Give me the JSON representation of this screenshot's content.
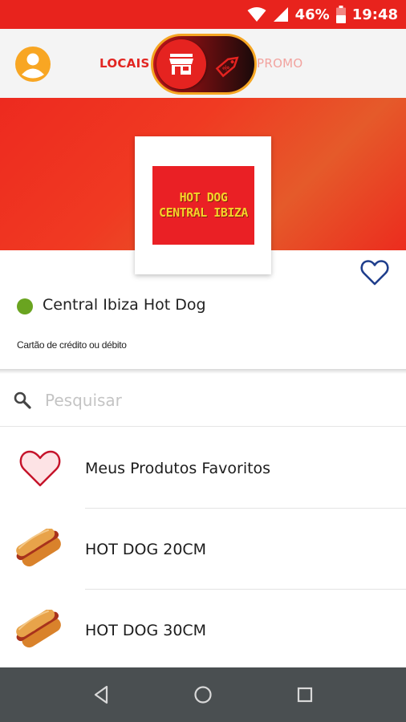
{
  "status_bar": {
    "battery": "46%",
    "time": "19:48",
    "icons": [
      "wifi-icon",
      "signal-icon",
      "battery-icon"
    ]
  },
  "header": {
    "tab_left": "LOCAIS",
    "tab_right": "PROMO",
    "toggle_selected": "LOCAIS",
    "toggle_icons": [
      "store-icon",
      "price-tag-icon"
    ],
    "avatar_icon": "user-avatar-icon"
  },
  "store": {
    "logo_line1": "HOT DOG",
    "logo_line2": "CENTRAL IBIZA",
    "name": "Central Ibiza Hot Dog",
    "status": "open",
    "payment": "Cartão de crédito ou débito",
    "favorite_icon": "heart-outline-icon"
  },
  "search": {
    "placeholder": "Pesquisar",
    "value": ""
  },
  "list": {
    "items": [
      {
        "label": "Meus Produtos Favoritos",
        "icon": "heart-icon"
      },
      {
        "label": "HOT DOG 20CM",
        "icon": "hot-dog-icon"
      },
      {
        "label": "HOT DOG 30CM",
        "icon": "hot-dog-icon"
      }
    ]
  },
  "nav_bar": {
    "buttons": [
      "back-icon",
      "home-icon",
      "recents-icon"
    ]
  },
  "colors": {
    "brand_red": "#e8231d",
    "accent_orange": "#f5a623",
    "open_green": "#6aa420",
    "heart_blue": "#1f3e8c",
    "nav_bar": "#4a4f51"
  }
}
